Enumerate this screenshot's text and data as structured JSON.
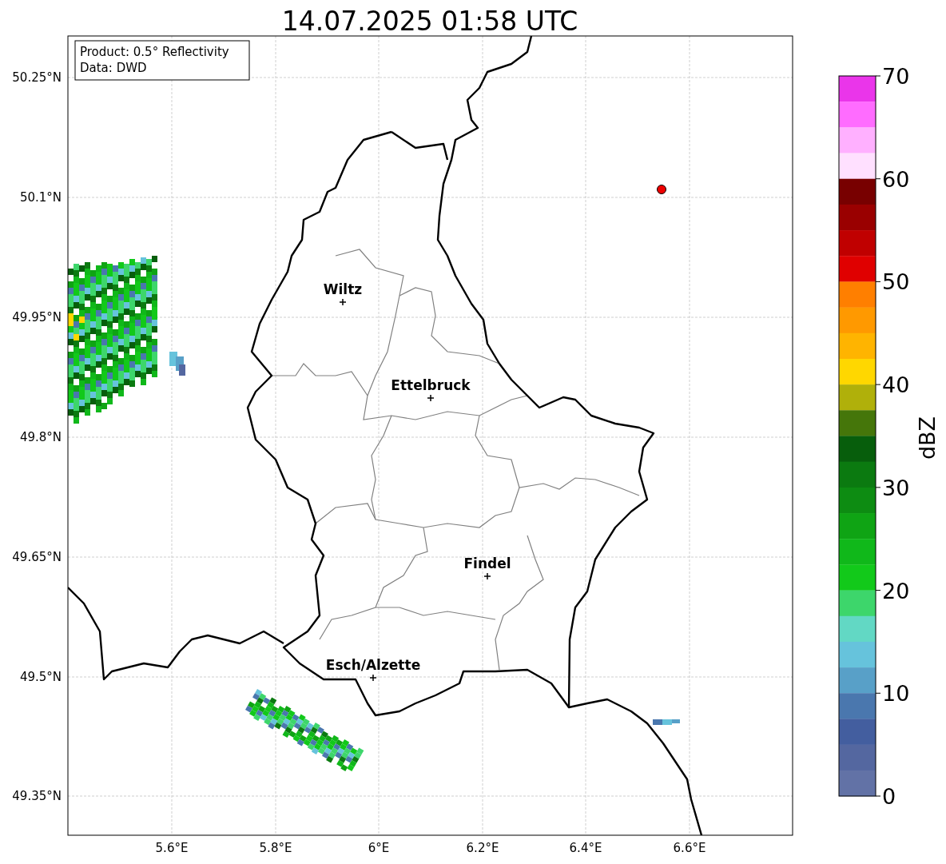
{
  "title": "14.07.2025 01:58 UTC",
  "info_box": [
    "Product: 0.5° Reflectivity",
    "Data: DWD"
  ],
  "map": {
    "lat_labels": [
      "50.25°N",
      "50.1°N",
      "49.95°N",
      "49.8°N",
      "49.65°N",
      "49.5°N",
      "49.35°N"
    ],
    "lon_labels": [
      "5.6°E",
      "5.8°E",
      "6°E",
      "6.2°E",
      "6.4°E",
      "6.6°E"
    ],
    "places": [
      {
        "name": "Wiltz"
      },
      {
        "name": "Ettelbruck"
      },
      {
        "name": "Findel"
      },
      {
        "name": "Esch/Alzette"
      }
    ]
  },
  "colorbar": {
    "label": "dBZ",
    "ticks": [
      "70",
      "60",
      "50",
      "40",
      "30",
      "20",
      "10",
      "0"
    ],
    "bins": [
      {
        "color": "#ea35ea"
      },
      {
        "color": "#ff6cff"
      },
      {
        "color": "#ffb0ff"
      },
      {
        "color": "#ffe0ff"
      },
      {
        "color": "#780000"
      },
      {
        "color": "#9a0000"
      },
      {
        "color": "#c00000"
      },
      {
        "color": "#e00000"
      },
      {
        "color": "#ff7f00"
      },
      {
        "color": "#ff9900"
      },
      {
        "color": "#ffb400"
      },
      {
        "color": "#ffd700"
      },
      {
        "color": "#b0b00a"
      },
      {
        "color": "#45760a"
      },
      {
        "color": "#075e0c"
      },
      {
        "color": "#0b7a10"
      },
      {
        "color": "#0d8c12"
      },
      {
        "color": "#0fa414"
      },
      {
        "color": "#10b81a"
      },
      {
        "color": "#12c91a"
      },
      {
        "color": "#3dd66b"
      },
      {
        "color": "#62d8c4"
      },
      {
        "color": "#66c3dc"
      },
      {
        "color": "#58a0c8"
      },
      {
        "color": "#4a77ae"
      },
      {
        "color": "#435e9f"
      },
      {
        "color": "#5467a0"
      },
      {
        "color": "#6272a6"
      }
    ]
  }
}
